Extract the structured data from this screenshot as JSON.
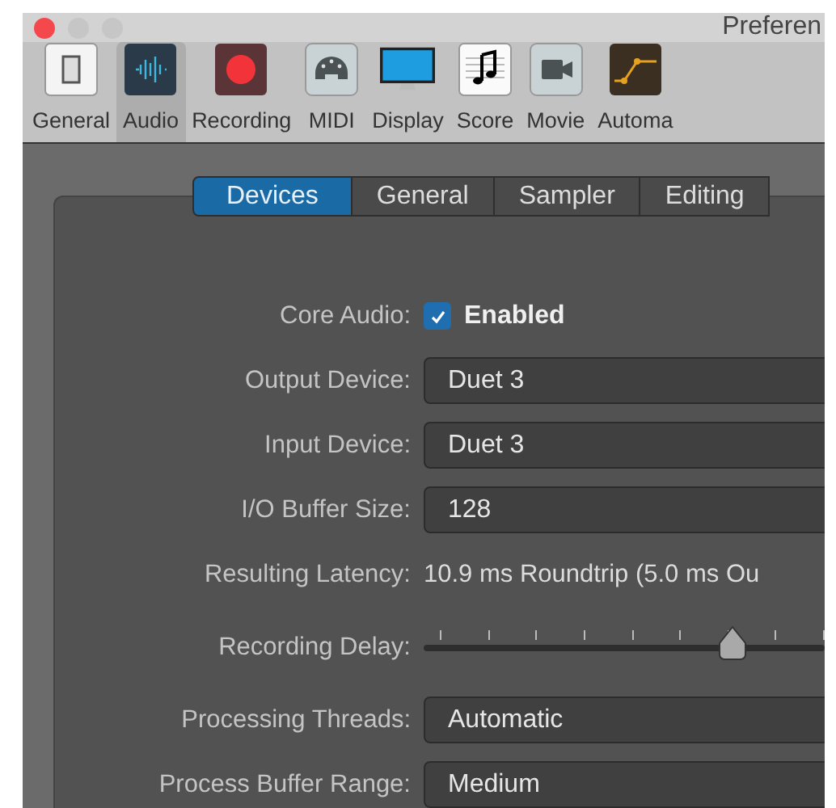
{
  "window": {
    "title": "Preferen"
  },
  "toolbar": [
    {
      "label": "General",
      "selected": false
    },
    {
      "label": "Audio",
      "selected": true
    },
    {
      "label": "Recording",
      "selected": false
    },
    {
      "label": "MIDI",
      "selected": false
    },
    {
      "label": "Display",
      "selected": false
    },
    {
      "label": "Score",
      "selected": false
    },
    {
      "label": "Movie",
      "selected": false
    },
    {
      "label": "Automa",
      "selected": false
    }
  ],
  "tabs": [
    {
      "label": "Devices",
      "selected": true
    },
    {
      "label": "General",
      "selected": false
    },
    {
      "label": "Sampler",
      "selected": false
    },
    {
      "label": "Editing",
      "selected": false
    }
  ],
  "settings": [
    {
      "kind": "checkbox",
      "label": "Core Audio:",
      "value": "Enabled",
      "checked": true
    },
    {
      "kind": "popup",
      "label": "Output Device:",
      "value": "Duet 3"
    },
    {
      "kind": "popup",
      "label": "Input Device:",
      "value": "Duet 3"
    },
    {
      "kind": "popup",
      "label": "I/O Buffer Size:",
      "value": "128"
    },
    {
      "kind": "text",
      "label": "Resulting Latency:",
      "value": "10.9 ms Roundtrip (5.0 ms Ou"
    },
    {
      "kind": "slider",
      "label": "Recording Delay:",
      "level": 0.77
    },
    {
      "kind": "popup",
      "label": "Processing Threads:",
      "value": "Automatic"
    },
    {
      "kind": "popup",
      "label": "Process Buffer Range:",
      "value": "Medium"
    }
  ]
}
